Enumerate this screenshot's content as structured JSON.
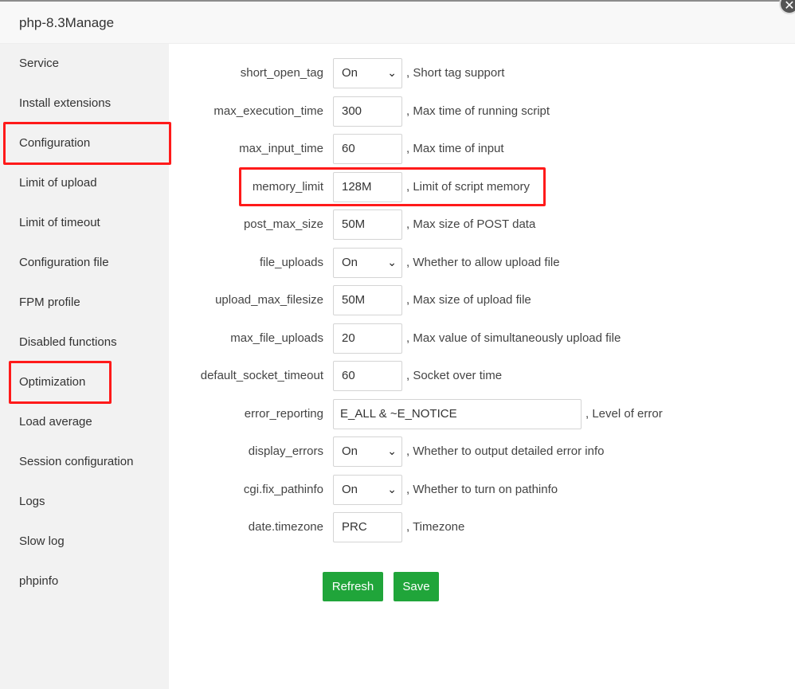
{
  "window": {
    "title": "php-8.3Manage",
    "close_glyph": "✕"
  },
  "sidebar": {
    "items": [
      {
        "label": "Service"
      },
      {
        "label": "Install extensions"
      },
      {
        "label": "Configuration"
      },
      {
        "label": "Limit of upload"
      },
      {
        "label": "Limit of timeout"
      },
      {
        "label": "Configuration file"
      },
      {
        "label": "FPM profile"
      },
      {
        "label": "Disabled functions"
      },
      {
        "label": "Optimization"
      },
      {
        "label": "Load average"
      },
      {
        "label": "Session configuration"
      },
      {
        "label": "Logs"
      },
      {
        "label": "Slow log"
      },
      {
        "label": "phpinfo"
      }
    ]
  },
  "config": {
    "rows": [
      {
        "label": "short_open_tag",
        "value": "On",
        "type": "select",
        "desc": ", Short tag support"
      },
      {
        "label": "max_execution_time",
        "value": "300",
        "type": "input",
        "desc": ", Max time of running script"
      },
      {
        "label": "max_input_time",
        "value": "60",
        "type": "input",
        "desc": ", Max time of input"
      },
      {
        "label": "memory_limit",
        "value": "128M",
        "type": "input",
        "desc": ", Limit of script memory"
      },
      {
        "label": "post_max_size",
        "value": "50M",
        "type": "input",
        "desc": ", Max size of POST data"
      },
      {
        "label": "file_uploads",
        "value": "On",
        "type": "select",
        "desc": ", Whether to allow upload file"
      },
      {
        "label": "upload_max_filesize",
        "value": "50M",
        "type": "input",
        "desc": ", Max size of upload file"
      },
      {
        "label": "max_file_uploads",
        "value": "20",
        "type": "input",
        "desc": ", Max value of simultaneously upload file"
      },
      {
        "label": "default_socket_timeout",
        "value": "60",
        "type": "input",
        "desc": ", Socket over time"
      },
      {
        "label": "error_reporting",
        "value": "E_ALL & ~E_NOTICE",
        "type": "input-wide",
        "desc": ", Level of error"
      },
      {
        "label": "display_errors",
        "value": "On",
        "type": "select",
        "desc": ", Whether to output detailed error info"
      },
      {
        "label": "cgi.fix_pathinfo",
        "value": "On",
        "type": "select",
        "desc": ", Whether to turn on pathinfo"
      },
      {
        "label": "date.timezone",
        "value": "PRC",
        "type": "input",
        "desc": ", Timezone"
      }
    ]
  },
  "actions": {
    "refresh_label": "Refresh",
    "save_label": "Save"
  },
  "colors": {
    "accent_green": "#20a53a",
    "highlight_red": "#ff1a1a"
  }
}
